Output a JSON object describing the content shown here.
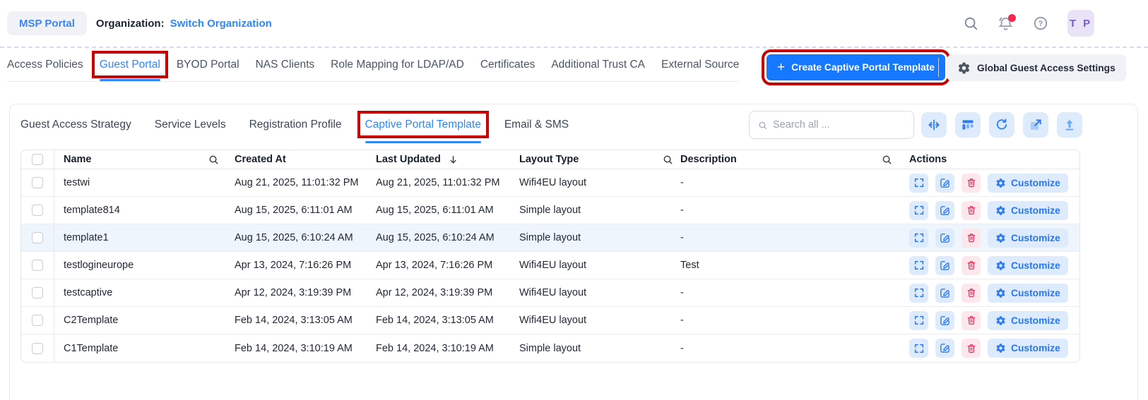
{
  "header": {
    "msp_portal": "MSP Portal",
    "organization_label": "Organization:",
    "organization_name": "Switch Organization",
    "avatar_initials": "T P"
  },
  "main_tabs": {
    "active": "Guest Portal",
    "items": [
      {
        "label": "Access Policies"
      },
      {
        "label": "Guest Portal"
      },
      {
        "label": "BYOD Portal"
      },
      {
        "label": "NAS Clients"
      },
      {
        "label": "Role Mapping for LDAP/AD"
      },
      {
        "label": "Certificates"
      },
      {
        "label": "Additional Trust CA"
      },
      {
        "label": "External Source"
      }
    ]
  },
  "header_actions": {
    "create_template": "Create Captive Portal Template",
    "global_settings": "Global Guest Access Settings"
  },
  "sub_tabs": {
    "active": "Captive Portal Template",
    "items": [
      {
        "label": "Guest Access Strategy"
      },
      {
        "label": "Service Levels"
      },
      {
        "label": "Registration Profile"
      },
      {
        "label": "Captive Portal Template"
      },
      {
        "label": "Email & SMS"
      }
    ]
  },
  "toolbar": {
    "search_placeholder": "Search all ...",
    "icons": [
      "column-resize",
      "table-columns",
      "refresh",
      "open-in-new",
      "export-upload"
    ]
  },
  "table": {
    "columns": {
      "name": "Name",
      "created_at": "Created At",
      "last_updated": "Last Updated",
      "layout_type": "Layout Type",
      "description": "Description",
      "actions": "Actions"
    },
    "sorted_by": "Last Updated",
    "sort_direction": "descending",
    "customize_label": "Customize",
    "rows": [
      {
        "name": "testwi",
        "created_at": "Aug 21, 2025, 11:01:32 PM",
        "last_updated": "Aug 21, 2025, 11:01:32 PM",
        "layout_type": "Wifi4EU layout",
        "description": "-",
        "highlighted": false
      },
      {
        "name": "template814",
        "created_at": "Aug 15, 2025, 6:11:01 AM",
        "last_updated": "Aug 15, 2025, 6:11:01 AM",
        "layout_type": "Simple layout",
        "description": "-",
        "highlighted": false
      },
      {
        "name": "template1",
        "created_at": "Aug 15, 2025, 6:10:24 AM",
        "last_updated": "Aug 15, 2025, 6:10:24 AM",
        "layout_type": "Simple layout",
        "description": "-",
        "highlighted": true
      },
      {
        "name": "testlogineurope",
        "created_at": "Apr 13, 2024, 7:16:26 PM",
        "last_updated": "Apr 13, 2024, 7:16:26 PM",
        "layout_type": "Wifi4EU layout",
        "description": "Test",
        "highlighted": false
      },
      {
        "name": "testcaptive",
        "created_at": "Apr 12, 2024, 3:19:39 PM",
        "last_updated": "Apr 12, 2024, 3:19:39 PM",
        "layout_type": "Wifi4EU layout",
        "description": "-",
        "highlighted": false
      },
      {
        "name": "C2Template",
        "created_at": "Feb 14, 2024, 3:13:05 AM",
        "last_updated": "Feb 14, 2024, 3:13:05 AM",
        "layout_type": "Wifi4EU layout",
        "description": "-",
        "highlighted": false
      },
      {
        "name": "C1Template",
        "created_at": "Feb 14, 2024, 3:10:19 AM",
        "last_updated": "Feb 14, 2024, 3:10:19 AM",
        "layout_type": "Simple layout",
        "description": "-",
        "highlighted": false
      }
    ]
  },
  "colors": {
    "accent_blue": "#1677ff",
    "link_blue": "#2e86f7",
    "annotation_red": "#c40000",
    "icon_button_bg": "#ddebfc",
    "danger_red": "#e8395f",
    "danger_bg": "#fbe7ec",
    "row_highlight": "#eef5fd",
    "avatar_bg": "#e9e3f8",
    "avatar_text": "#7a5ad1"
  }
}
